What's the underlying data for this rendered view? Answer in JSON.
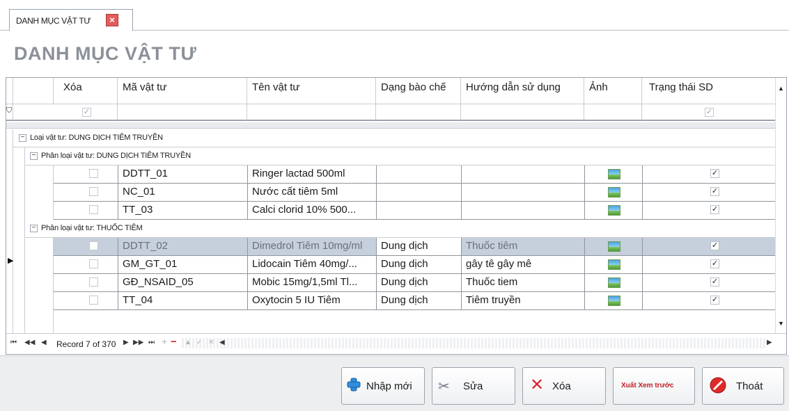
{
  "tab": {
    "label": "DANH MỤC VẬT TƯ",
    "close_icon": "close-icon"
  },
  "page_title": "DANH MỤC VẬT TƯ",
  "columns": {
    "xoa": "Xóa",
    "ma": "Mã vật tư",
    "ten": "Tên vật tư",
    "dang": "Dạng bào chế",
    "huong": "Hướng dẫn sử dụng",
    "anh": "Ảnh",
    "trang_thai": "Trạng thái SD"
  },
  "groups": {
    "loai": "Loại vật tư: DUNG DỊCH TIÊM TRUYỀN",
    "phan_loai_1": "Phân loại vật tư: DUNG DỊCH TIÊM TRUYỀN",
    "phan_loai_2": "Phân loại vật tư: THUỐC TIÊM"
  },
  "rows": [
    {
      "ma": "DDTT_01",
      "ten": "Ringer lactad 500ml",
      "dang": "",
      "huong": "",
      "checked": true
    },
    {
      "ma": "NC_01",
      "ten": "Nước cất tiêm 5ml",
      "dang": "",
      "huong": "",
      "checked": true
    },
    {
      "ma": "TT_03",
      "ten": "Calci clorid 10% 500...",
      "dang": "",
      "huong": "",
      "checked": true
    },
    {
      "ma": "DDTT_02",
      "ten": "Dimedrol Tiêm 10mg/ml",
      "dang": "Dung dịch",
      "huong": "Thuốc tiêm",
      "checked": true,
      "selected": true
    },
    {
      "ma": "GM_GT_01",
      "ten": "Lidocain Tiêm 40mg/...",
      "dang": "Dung dịch",
      "huong": "gây tê gây mê",
      "checked": true
    },
    {
      "ma": "GĐ_NSAID_05",
      "ten": "Mobic 15mg/1,5ml Tl...",
      "dang": "Dung dịch",
      "huong": "Thuốc tiem",
      "checked": true
    },
    {
      "ma": "TT_04",
      "ten": "Oxytocin 5 IU Tiêm",
      "dang": "Dung dịch",
      "huong": "Tiêm truyền",
      "checked": true
    }
  ],
  "navigator": {
    "record_text": "Record 7 of 370"
  },
  "buttons": {
    "nhap_moi": "Nhập mới",
    "sua": "Sửa",
    "xoa": "Xóa",
    "xem_truoc": "Xuất Xem trước",
    "thoat": "Thoát"
  },
  "colors": {
    "selected_row": "#c6d0dc",
    "title_grey": "#8c9199",
    "delete_red": "#d9262b"
  }
}
